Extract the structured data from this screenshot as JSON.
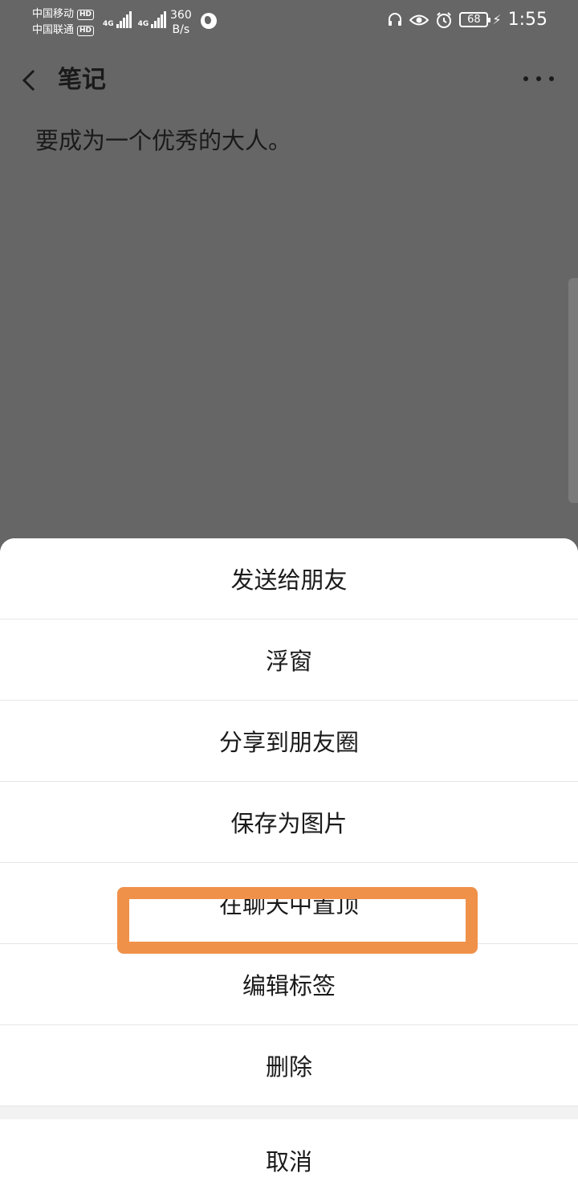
{
  "status_bar": {
    "carrier_1": "中国移动",
    "carrier_2": "中国联通",
    "hd_badge": "HD",
    "network_tag": "4G",
    "speed_value": "360",
    "speed_unit": "B/s",
    "battery": "68",
    "time": "1:55"
  },
  "header": {
    "title": "笔记"
  },
  "note": {
    "text": "要成为一个优秀的大人。"
  },
  "action_sheet": {
    "items": [
      {
        "label": "发送给朋友"
      },
      {
        "label": "浮窗"
      },
      {
        "label": "分享到朋友圈"
      },
      {
        "label": "保存为图片"
      },
      {
        "label": "在聊天中置顶"
      },
      {
        "label": "编辑标签"
      },
      {
        "label": "删除"
      }
    ],
    "cancel_label": "取消"
  },
  "colors": {
    "dim_overlay": "#666666",
    "highlight": "#f0914a"
  }
}
